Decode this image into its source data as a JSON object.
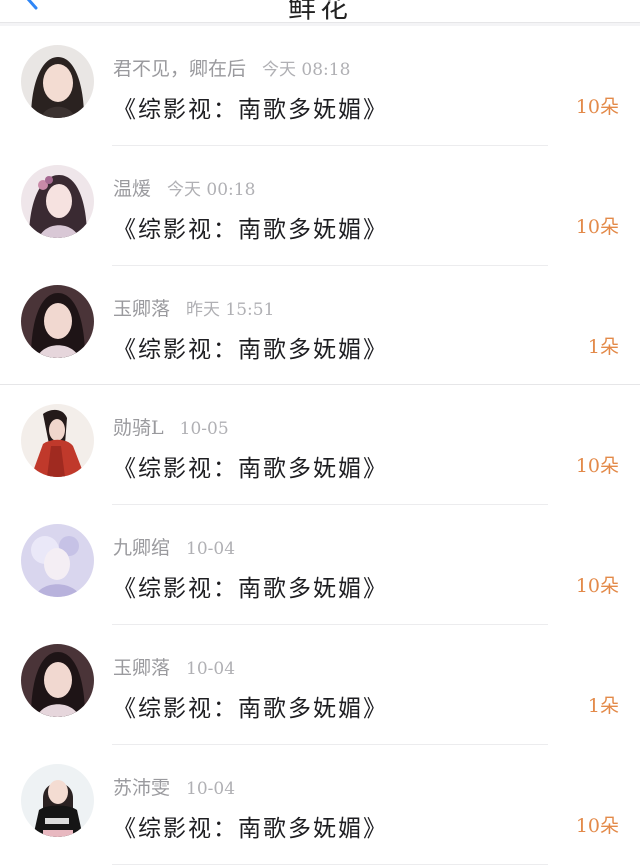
{
  "header": {
    "title": "鲜花",
    "back_icon": "chevron-left-icon",
    "accent": "#2f86f6"
  },
  "colors": {
    "count": "#e38a4a",
    "meta": "#9a9a9e"
  },
  "rows": [
    {
      "name": "君不见，卿在后",
      "time": "今天 08:18",
      "title": "《综影视：南歌多妩媚》",
      "count": "10朵"
    },
    {
      "name": "温煖",
      "time": "今天 00:18",
      "title": "《综影视：南歌多妩媚》",
      "count": "10朵"
    },
    {
      "name": "玉卿落",
      "time": "昨天 15:51",
      "title": "《综影视：南歌多妩媚》",
      "count": "1朵"
    },
    {
      "name": "勋骑L",
      "time": "10-05",
      "title": "《综影视：南歌多妩媚》",
      "count": "10朵"
    },
    {
      "name": "九卿绾",
      "time": "10-04",
      "title": "《综影视：南歌多妩媚》",
      "count": "10朵"
    },
    {
      "name": "玉卿落",
      "time": "10-04",
      "title": "《综影视：南歌多妩媚》",
      "count": "1朵"
    },
    {
      "name": "苏沛雯",
      "time": "10-04",
      "title": "《综影视：南歌多妩媚》",
      "count": "10朵"
    }
  ]
}
